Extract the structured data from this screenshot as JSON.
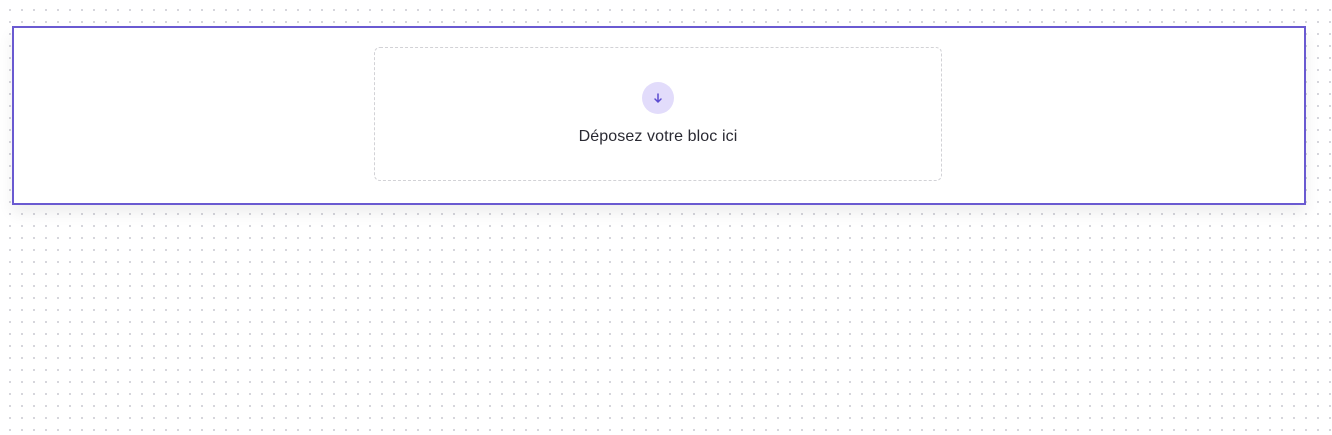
{
  "dropzone": {
    "label": "Déposez votre bloc ici",
    "icon": "arrow-down-icon"
  },
  "colors": {
    "accent": "#6a5ad1",
    "icon_bg": "#e2dcfb",
    "text": "#2a2a33",
    "dropzone_border": "#d2d2d6"
  }
}
